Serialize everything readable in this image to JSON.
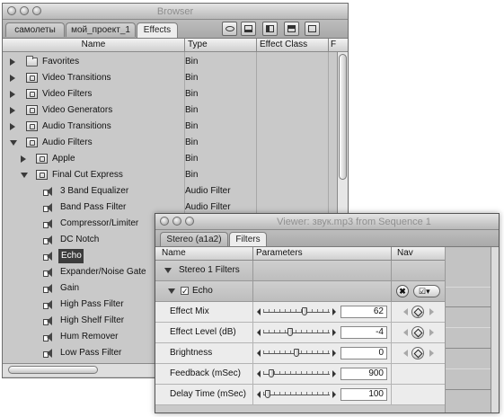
{
  "browser": {
    "title": "Browser",
    "tabs": [
      "самолеты",
      "мой_проект_1",
      "Effects"
    ],
    "active_tab": "Effects",
    "toolbar_buttons": [
      "view-icon",
      "layout-icon-1",
      "layout-icon-2",
      "layout-icon-3",
      "layout-icon-4"
    ],
    "columns": {
      "name": "Name",
      "type": "Type",
      "effect_class": "Effect Class",
      "extra": "F"
    },
    "rows": [
      {
        "name": "Favorites",
        "type": "Bin",
        "icon": "folder-icon",
        "expander": "collapsed"
      },
      {
        "name": "Video Transitions",
        "type": "Bin",
        "icon": "bin-icon",
        "expander": "collapsed"
      },
      {
        "name": "Video Filters",
        "type": "Bin",
        "icon": "bin-icon",
        "expander": "collapsed"
      },
      {
        "name": "Video Generators",
        "type": "Bin",
        "icon": "bin-icon",
        "expander": "collapsed"
      },
      {
        "name": "Audio Transitions",
        "type": "Bin",
        "icon": "bin-icon",
        "expander": "collapsed"
      },
      {
        "name": "Audio Filters",
        "type": "Bin",
        "icon": "bin-icon",
        "expander": "expanded"
      },
      {
        "name": "Apple",
        "type": "Bin",
        "icon": "bin-icon",
        "expander": "collapsed"
      },
      {
        "name": "Final Cut Express",
        "type": "Bin",
        "icon": "bin-icon",
        "expander": "expanded"
      },
      {
        "name": "3 Band Equalizer",
        "type": "Audio Filter",
        "icon": "audio-filter-icon"
      },
      {
        "name": "Band Pass Filter",
        "type": "Audio Filter",
        "icon": "audio-filter-icon"
      },
      {
        "name": "Compressor/Limiter",
        "type": "",
        "icon": "audio-filter-icon"
      },
      {
        "name": "DC Notch",
        "type": "",
        "icon": "audio-filter-icon"
      },
      {
        "name": "Echo",
        "type": "",
        "icon": "audio-filter-icon",
        "selected": true
      },
      {
        "name": "Expander/Noise Gate",
        "type": "",
        "icon": "audio-filter-icon"
      },
      {
        "name": "Gain",
        "type": "",
        "icon": "audio-filter-icon"
      },
      {
        "name": "High Pass Filter",
        "type": "",
        "icon": "audio-filter-icon"
      },
      {
        "name": "High Shelf Filter",
        "type": "",
        "icon": "audio-filter-icon"
      },
      {
        "name": "Hum Remover",
        "type": "",
        "icon": "audio-filter-icon"
      },
      {
        "name": "Low Pass Filter",
        "type": "",
        "icon": "audio-filter-icon"
      }
    ]
  },
  "viewer": {
    "title": "Viewer: звук.mp3 from Sequence 1",
    "tabs": [
      "Stereo (a1a2)",
      "Filters"
    ],
    "active_tab": "Filters",
    "columns": {
      "name": "Name",
      "parameters": "Parameters",
      "nav": "Nav"
    },
    "group_label": "Stereo 1 Filters",
    "filter_name": "Echo",
    "filter_enabled": true,
    "check_mark": "✓",
    "remove_glyph": "✖",
    "menu_glyph": "☑▾",
    "params": [
      {
        "label": "Effect Mix",
        "value": "62",
        "slider_fraction": 0.62,
        "keyframe_nav": true
      },
      {
        "label": "Effect Level (dB)",
        "value": "-4",
        "slider_fraction": 0.4,
        "keyframe_nav": true
      },
      {
        "label": "Brightness",
        "value": "0",
        "slider_fraction": 0.5,
        "keyframe_nav": true
      },
      {
        "label": "Feedback (mSec)",
        "value": "900",
        "slider_fraction": 0.12,
        "keyframe_nav": false
      },
      {
        "label": "Delay Time (mSec)",
        "value": "100",
        "slider_fraction": 0.07,
        "keyframe_nav": false
      }
    ]
  }
}
